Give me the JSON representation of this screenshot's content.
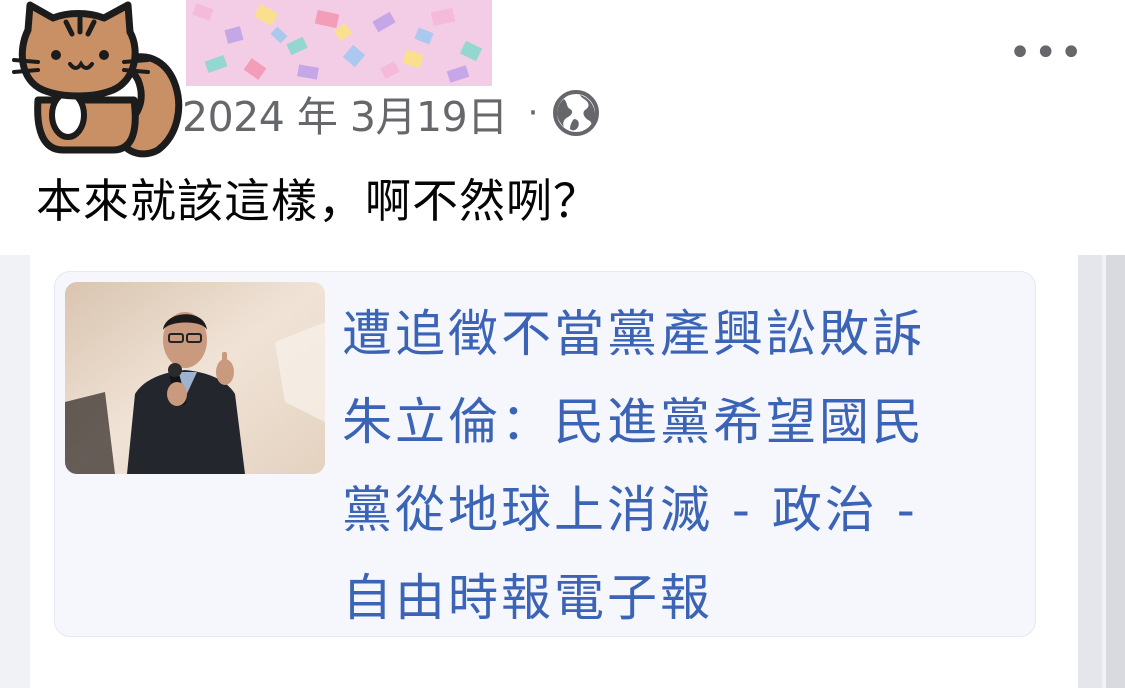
{
  "post": {
    "date": "2024 年 3月19日",
    "separator": "·",
    "audience_icon": "globe-icon",
    "more_label": "•••",
    "text": "本來就該這樣，啊不然咧？"
  },
  "link_preview": {
    "headline": "遭追徵不當黨產興訟敗訴\n朱立倫：民進黨希望國民\n黨從地球上消滅 - 政治 -\n自由時報電子報"
  },
  "colors": {
    "headline": "#3b63b6",
    "meta_text": "#65676b",
    "body_text": "#050505",
    "card_bg": "#f6f7fd"
  }
}
